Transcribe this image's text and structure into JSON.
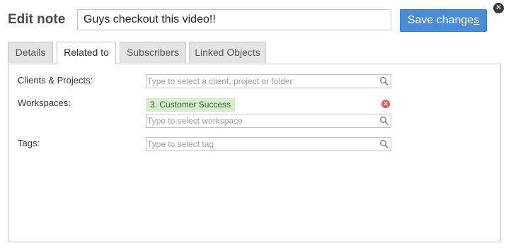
{
  "dialog": {
    "title": "Edit note",
    "note_value": "Guys checkout this video!!",
    "save_label_main": "Save change",
    "save_label_underlined": "s",
    "close_icon": "close-icon"
  },
  "tabs": [
    {
      "label": "Details",
      "active": false
    },
    {
      "label": "Related to",
      "active": true
    },
    {
      "label": "Subscribers",
      "active": false
    },
    {
      "label": "Linked Objects",
      "active": false
    }
  ],
  "related": {
    "clients": {
      "label": "Clients & Projects:",
      "placeholder": "Type to select a client, project or folder"
    },
    "workspaces": {
      "label": "Workspaces:",
      "chip": "3. Customer Success",
      "placeholder": "Type to select workspace"
    },
    "tags": {
      "label": "Tags:",
      "placeholder": "Type to select tag"
    }
  },
  "colors": {
    "accent": "#4c8bd6",
    "chip_bg": "#d8ead0",
    "remove": "#e06060"
  }
}
